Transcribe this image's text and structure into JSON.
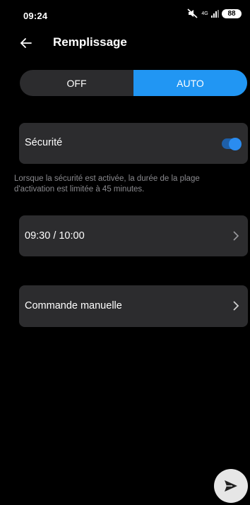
{
  "status_bar": {
    "time": "09:24",
    "network": "4G",
    "battery": "88",
    "icons": [
      "mute-icon",
      "network-4g-icon",
      "signal-icon",
      "battery-icon"
    ]
  },
  "header": {
    "title": "Remplissage",
    "back_icon": "back-arrow-icon"
  },
  "mode_toggle": {
    "options": [
      "OFF",
      "AUTO"
    ],
    "selected": "AUTO"
  },
  "security": {
    "label": "Sécurité",
    "enabled": true,
    "helper_text": "Lorsque la sécurité est activée, la durée de la plage d'activation est limitée à 45 minutes."
  },
  "schedule": {
    "label": "09:30 / 10:00"
  },
  "manual": {
    "label": "Commande manuelle"
  },
  "fab": {
    "icon": "send-icon"
  },
  "colors": {
    "accent": "#2196f3",
    "card": "#2c2c2e",
    "background": "#000000"
  }
}
